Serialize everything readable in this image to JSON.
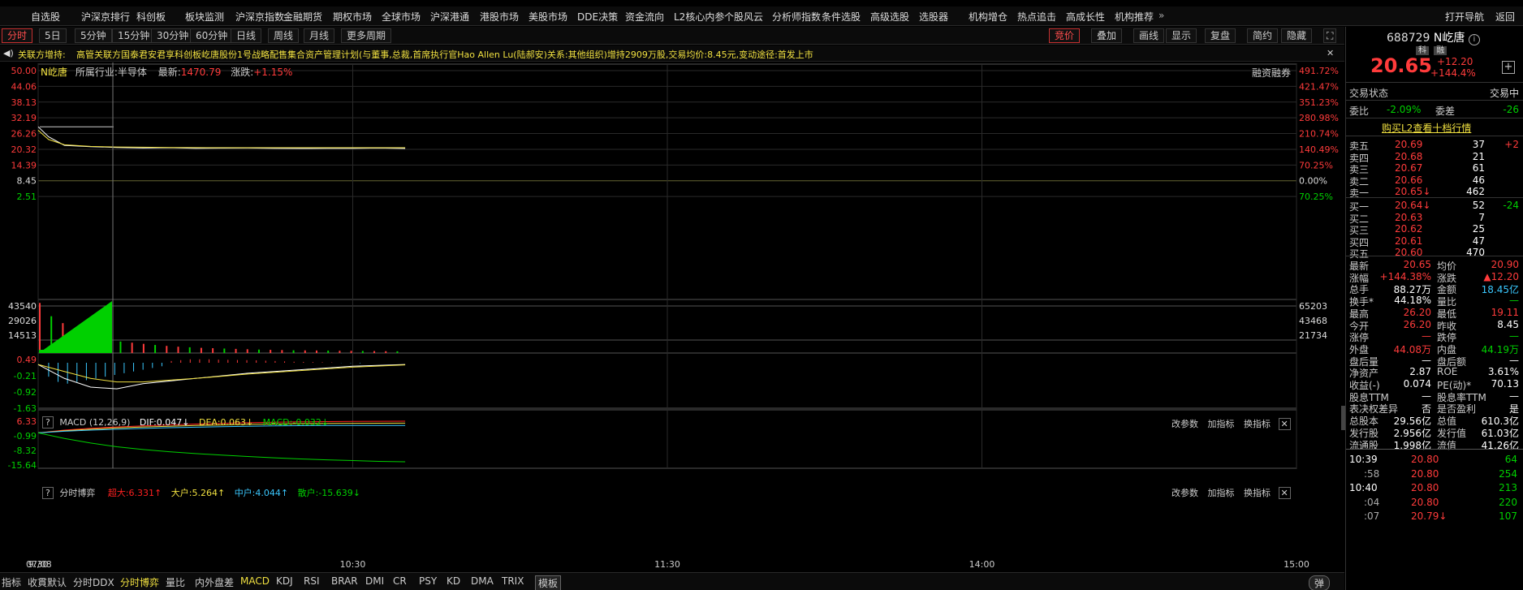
{
  "top_nav": {
    "items": [
      "自选股",
      "沪深京排行",
      "科创板",
      "板块监测",
      "沪深京指数",
      "金融期货",
      "期权市场",
      "全球市场",
      "沪深港通",
      "港股市场",
      "美股市场",
      "DDE决策",
      "资金流向",
      "L2核心内参",
      "个股风云",
      "分析师指数",
      "条件选股",
      "高级选股",
      "选股器",
      "机构增仓",
      "热点追击",
      "高成长性",
      "机构推荐"
    ],
    "right_items": [
      "打开导航",
      "返回"
    ]
  },
  "toolbar": {
    "period_buttons": [
      "分时",
      "5日",
      "5分钟",
      "15分钟",
      "30分钟",
      "60分钟",
      "日线",
      "周线",
      "月线",
      "更多周期"
    ],
    "right_buttons": [
      "竞价",
      "叠加",
      "画线",
      "显示",
      "复盘",
      "简约",
      "隐藏"
    ]
  },
  "notice": {
    "prefix": "关联方增持:",
    "text": "高管关联方国泰君安君享科创板屹唐股份1号战略配售集合资产管理计划(与董事,总裁,首席执行官Hao Allen Lu(陆郝安)关系:其他组织)增持2909万股,交易均价:8.45元,变动途径:首发上市"
  },
  "chart_header": {
    "stock_name": "N屹唐",
    "industry_label": "所属行业:",
    "industry_value": "半导体",
    "latest_label": "最新:",
    "latest_value": "1470.79",
    "change_label": "涨跌:",
    "change_value": "+1.15%",
    "margin_trading": "融资融券"
  },
  "price_panel": {
    "y_left_labels": [
      "50.00",
      "44.06",
      "38.13",
      "32.19",
      "26.26",
      "20.32",
      "14.39",
      "8.45",
      "2.51"
    ],
    "y_right_labels": [
      "491.72%",
      "421.47%",
      "351.23%",
      "280.98%",
      "210.74%",
      "140.49%",
      "70.25%",
      "0.00%",
      "70.25%"
    ]
  },
  "volume_panel": {
    "y_left_labels": [
      "43540",
      "29026",
      "14513"
    ],
    "y_right_labels": [
      "65203",
      "43468",
      "21734"
    ]
  },
  "macd_panel": {
    "title": "MACD (12,26,9)",
    "dif": "DIF:0.047↓",
    "dea": "DEA:0.063↓",
    "macd": "MACD:-0.032↓",
    "y_labels": [
      "0.49",
      "-0.21",
      "-0.92",
      "-1.63"
    ],
    "actions": [
      "改参数",
      "加指标",
      "换指标"
    ]
  },
  "fund_panel": {
    "title": "分时博弈",
    "super": "超大:6.331↑",
    "large": "大户:5.264↑",
    "medium": "中户:4.044↑",
    "retail": "散户:-15.639↓",
    "y_labels": [
      "6.33",
      "-0.99",
      "-8.32",
      "-15.64"
    ],
    "actions": [
      "改参数",
      "加指标",
      "换指标"
    ]
  },
  "x_axis": [
    "07/08",
    "9:30",
    "10:30",
    "11:30",
    "14:00",
    "15:00"
  ],
  "bottom_tabs": [
    "指标",
    "收貫默认",
    "分时DDX",
    "分时博弈",
    "量比",
    "内外盘差",
    "MACD",
    "KDJ",
    "RSI",
    "BRAR",
    "DMI",
    "CR",
    "PSY",
    "KD",
    "DMA",
    "TRIX",
    "模板"
  ],
  "bottom_right": "弹",
  "chart_data": [
    {
      "type": "line",
      "name": "price",
      "ylim": [
        2.51,
        50.0
      ],
      "x": [
        "9:30",
        "9:32",
        "9:35",
        "9:40",
        "9:45",
        "9:50",
        "9:55",
        "10:00",
        "10:05",
        "10:10",
        "10:15",
        "10:20",
        "10:25",
        "10:30",
        "10:35",
        "10:40"
      ],
      "series": [
        {
          "values": [
            28.8,
            25.0,
            21.8,
            21.3,
            21.0,
            20.8,
            20.9,
            20.7,
            20.75,
            20.8,
            20.7,
            20.65,
            20.7,
            20.7,
            20.8,
            20.65
          ]
        },
        {
          "values": [
            27.5,
            24.0,
            22.0,
            21.4,
            21.2,
            21.1,
            21.0,
            20.95,
            20.92,
            20.92,
            20.91,
            20.9,
            20.9,
            20.9,
            20.9,
            20.9
          ]
        }
      ]
    },
    {
      "type": "bar",
      "name": "volume",
      "ylim": [
        0,
        65203
      ],
      "values": [
        43540,
        32000,
        26000,
        21000,
        17000,
        15000,
        12000,
        10000,
        9000,
        8000,
        7000,
        6200,
        5500,
        5000,
        4500,
        4200,
        3900,
        3600,
        3300,
        3000,
        2800,
        2600,
        2400,
        2300,
        2200,
        2100,
        2000,
        1900,
        1800,
        1700,
        1600,
        1500
      ]
    },
    {
      "type": "bar",
      "name": "macd",
      "ylim": [
        -1.63,
        0.49
      ],
      "values": [
        -0.8,
        -1.1,
        -1.2,
        -1.1,
        -1.0,
        -0.9,
        -0.8,
        -0.7,
        -0.6,
        -0.5,
        -0.4,
        -0.3,
        -0.2,
        0.1,
        0.15,
        0.2,
        0.2,
        0.2,
        0.18,
        0.17,
        0.16,
        0.15,
        0.14,
        0.12,
        0.1,
        0.08,
        0.06,
        0.05,
        0.04,
        0.03,
        0.02,
        -0.01,
        -0.02,
        -0.03
      ]
    },
    {
      "type": "line",
      "name": "fund_flow",
      "ylim": [
        -15.64,
        6.33
      ],
      "series": [
        {
          "name": "超大",
          "values": [
            0,
            1.5,
            2.5,
            3.2,
            3.8,
            4.3,
            4.8,
            5.2,
            5.5,
            5.8,
            6.0,
            6.1,
            6.2,
            6.3,
            6.331
          ]
        },
        {
          "name": "大户",
          "values": [
            0,
            1.2,
            2.0,
            2.7,
            3.2,
            3.6,
            4.0,
            4.3,
            4.6,
            4.8,
            5.0,
            5.1,
            5.2,
            5.25,
            5.264
          ]
        },
        {
          "name": "中户",
          "values": [
            0,
            0.9,
            1.5,
            2.0,
            2.4,
            2.8,
            3.1,
            3.4,
            3.6,
            3.8,
            3.9,
            4.0,
            4.02,
            4.04,
            4.044
          ]
        },
        {
          "name": "散户",
          "values": [
            0,
            -3.0,
            -5.5,
            -7.5,
            -9.0,
            -10.2,
            -11.2,
            -12.0,
            -12.8,
            -13.5,
            -14.1,
            -14.6,
            -15.0,
            -15.4,
            -15.639
          ]
        }
      ]
    }
  ],
  "right_panel": {
    "code": "688729",
    "name": "N屹唐",
    "tag1": "科",
    "tag2": "融",
    "price": "20.65",
    "change": "+12.20",
    "change_pct": "+144.4%",
    "status_label": "交易状态",
    "status_value": "交易中",
    "weibi_label": "委比",
    "weibi_value": "-2.09%",
    "weicha_label": "委差",
    "weicha_value": "-26",
    "l2_link": "购买L2查看十档行情",
    "asks": [
      {
        "label": "卖五",
        "price": "20.69",
        "vol": "37",
        "extra": "+2"
      },
      {
        "label": "卖四",
        "price": "20.68",
        "vol": "21",
        "extra": ""
      },
      {
        "label": "卖三",
        "price": "20.67",
        "vol": "61",
        "extra": ""
      },
      {
        "label": "卖二",
        "price": "20.66",
        "vol": "46",
        "extra": ""
      },
      {
        "label": "卖一",
        "price": "20.65↓",
        "vol": "462",
        "extra": ""
      }
    ],
    "bids": [
      {
        "label": "买一",
        "price": "20.64↓",
        "vol": "52",
        "extra": "-24"
      },
      {
        "label": "买二",
        "price": "20.63",
        "vol": "7",
        "extra": ""
      },
      {
        "label": "买三",
        "price": "20.62",
        "vol": "25",
        "extra": ""
      },
      {
        "label": "买四",
        "price": "20.61",
        "vol": "47",
        "extra": ""
      },
      {
        "label": "买五",
        "price": "20.60",
        "vol": "470",
        "extra": ""
      }
    ],
    "stats": [
      {
        "l1": "最新",
        "v1": "20.65",
        "c1": "red",
        "l2": "均价",
        "v2": "20.90",
        "c2": "red"
      },
      {
        "l1": "涨幅",
        "v1": "+144.38%",
        "c1": "red",
        "l2": "涨跌",
        "v2": "▲12.20",
        "c2": "red"
      },
      {
        "l1": "总手",
        "v1": "88.27万",
        "c1": "white",
        "l2": "金额",
        "v2": "18.45亿",
        "c2": "cyan"
      },
      {
        "l1": "换手*",
        "v1": "44.18%",
        "c1": "white",
        "l2": "量比",
        "v2": "—",
        "c2": "green"
      },
      {
        "l1": "最高",
        "v1": "26.20",
        "c1": "red",
        "l2": "最低",
        "v2": "19.11",
        "c2": "red"
      },
      {
        "l1": "今开",
        "v1": "26.20",
        "c1": "red",
        "l2": "昨收",
        "v2": "8.45",
        "c2": "white"
      },
      {
        "l1": "涨停",
        "v1": "—",
        "c1": "red",
        "l2": "跌停",
        "v2": "—",
        "c2": "green"
      },
      {
        "l1": "外盘",
        "v1": "44.08万",
        "c1": "red",
        "l2": "内盘",
        "v2": "44.19万",
        "c2": "green"
      },
      {
        "l1": "盘后量",
        "v1": "—",
        "c1": "white",
        "l2": "盘后额",
        "v2": "—",
        "c2": "white"
      },
      {
        "l1": "净资产",
        "v1": "2.87",
        "c1": "white",
        "l2": "ROE",
        "v2": "3.61%",
        "c2": "white"
      },
      {
        "l1": "收益(-)",
        "v1": "0.074",
        "c1": "white",
        "l2": "PE(动)*",
        "v2": "70.13",
        "c2": "white"
      },
      {
        "l1": "股息TTM",
        "v1": "—",
        "c1": "white",
        "l2": "股息率TTM",
        "v2": "—",
        "c2": "white"
      },
      {
        "l1": "表决权差异",
        "v1": "否",
        "c1": "white",
        "l2": "是否盈利",
        "v2": "是",
        "c2": "white"
      },
      {
        "l1": "总股本",
        "v1": "29.56亿",
        "c1": "white",
        "l2": "总值",
        "v2": "610.3亿",
        "c2": "white"
      },
      {
        "l1": "发行股",
        "v1": "2.956亿",
        "c1": "white",
        "l2": "发行值",
        "v2": "61.03亿",
        "c2": "white"
      },
      {
        "l1": "流通股",
        "v1": "1.998亿",
        "c1": "white",
        "l2": "流值",
        "v2": "41.26亿",
        "c2": "white"
      }
    ],
    "ticks": [
      {
        "time": "10:39",
        "price": "20.80",
        "vol": "64",
        "vc": "green"
      },
      {
        "time": ":58",
        "price": "20.80",
        "vol": "254",
        "vc": "green"
      },
      {
        "time": "10:40",
        "price": "20.80",
        "vol": "213",
        "vc": "green"
      },
      {
        "time": ":04",
        "price": "20.80",
        "vol": "220",
        "vc": "green"
      },
      {
        "time": ":07",
        "price": "20.79↓",
        "vol": "107",
        "vc": "green"
      }
    ]
  }
}
